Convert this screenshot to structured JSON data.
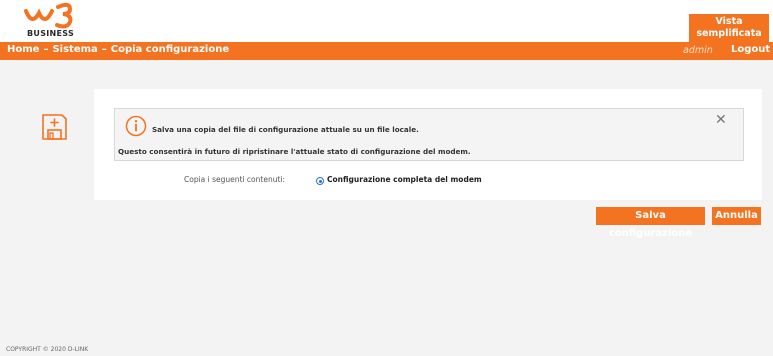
{
  "brand": {
    "logo_sub": "BUSINESS",
    "accent_color": "#f47321"
  },
  "header": {
    "view_button_line1": "Vista",
    "view_button_line2": "semplificata"
  },
  "nav": {
    "breadcrumb": [
      "Home",
      "Sistema",
      "Copia configurazione"
    ],
    "separator": "–",
    "user": "admin",
    "logout": "Logout"
  },
  "panel": {
    "icon": "save-file-icon",
    "info_line1": "Salva una copia del file di configurazione attuale su un file locale.",
    "info_line2": "Questo consentirà in futuro di ripristinare l'attuale stato di configurazione del modem.",
    "copy_label": "Copia i seguenti contenuti:",
    "option_label": "Configurazione completa del modem",
    "option_selected": true
  },
  "actions": {
    "save": "Salva configurazione",
    "cancel": "Annulla"
  },
  "footer": {
    "copyright": "COPYRIGHT © 2020 D-LINK"
  }
}
